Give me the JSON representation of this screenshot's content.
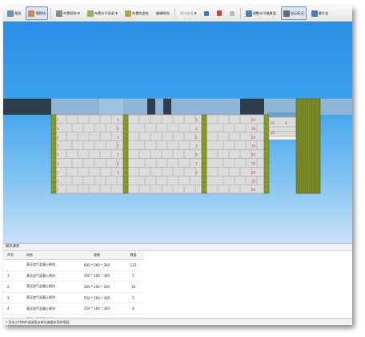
{
  "toolbar": {
    "view_label": "视图",
    "model_label": "墙砌块",
    "layout_label": "布置砌块",
    "horizontal_label": "布置水平系梁",
    "tie_label": "布置构造柱",
    "edit_label": "编辑砌块",
    "size_label": "砌块规格",
    "adjust_label": "调整水平缝厚度",
    "display_label": "显示标注",
    "maximize_label": "最大化",
    "icons": [
      "view-icon",
      "brick-icon",
      "layout-icon",
      "beam-icon",
      "column-icon",
      "edit-icon",
      "size-icon",
      "move-icon",
      "delete-icon",
      "undo-icon",
      "adjust-icon",
      "label-icon",
      "maximize-icon"
    ]
  },
  "scene": {
    "colors": {
      "sky_top": "#2c8fe7",
      "brick": "#dcdcdc",
      "mortar": "#9a9a9a",
      "column": "#8a9a2a",
      "beam": "#2f3d4d",
      "label": "#c0392b"
    },
    "left_block_labels": [
      "1",
      "3",
      "2",
      "3",
      "2",
      "3",
      "2",
      "3",
      "2"
    ],
    "right_block_labels": [
      "10",
      "10",
      "10",
      "10",
      "10",
      "10",
      "10",
      "10",
      "10"
    ],
    "mid_labels": [
      "3",
      "3",
      "3",
      "3",
      "3",
      "3",
      "3"
    ],
    "narrow_labels": [
      "10",
      "4",
      "10",
      "10",
      "4",
      "10",
      "10"
    ]
  },
  "panel": {
    "title": "砌块清单",
    "columns": [
      "序号",
      "材质",
      "规格",
      "数量"
    ],
    "rows": [
      {
        "no": "",
        "material": "蒸压加气混凝土砌块",
        "spec": "600 * 200 * 300",
        "count": "123"
      },
      {
        "no": "1",
        "material": "蒸压加气混凝土砌块",
        "spec": "450 * 200 * 300",
        "count": "5"
      },
      {
        "no": "2",
        "material": "蒸压加气混凝土砌块",
        "spec": "300 * 200 * 300",
        "count": "16"
      },
      {
        "no": "3",
        "material": "蒸压加气混凝土砌块",
        "spec": "550 * 200 * 300",
        "count": "5"
      },
      {
        "no": "4",
        "material": "蒸压加气混凝土砌块",
        "spec": "250 * 200 * 300",
        "count": "8"
      },
      {
        "no": "5",
        "material": "蒸压加气混凝土砌块",
        "spec": "500 * 200 * 300",
        "count": "2"
      }
    ]
  },
  "status_text": "• 双击二代构件或梁段支单位度量布局的墙段"
}
